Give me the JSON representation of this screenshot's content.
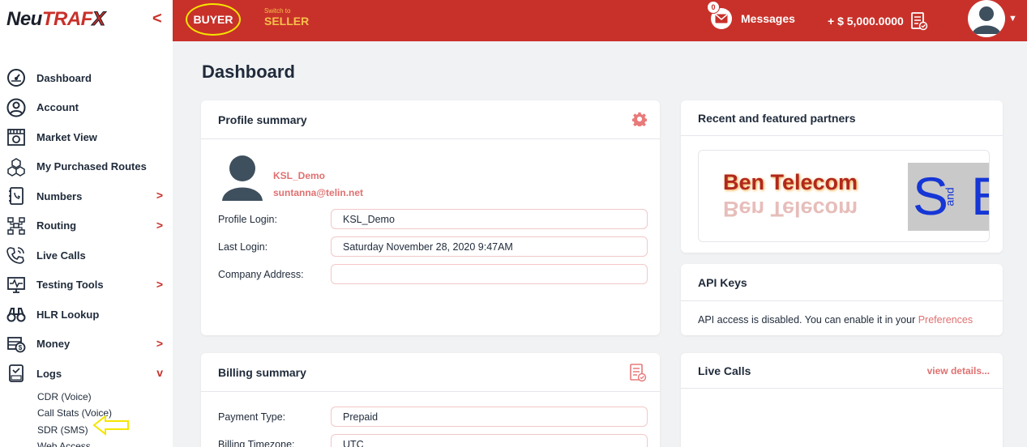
{
  "brand": {
    "neu": "Neu",
    "traf": "TRAF",
    "x": "X"
  },
  "sidebar": {
    "collapse_label": "<",
    "items": [
      {
        "label": "Dashboard",
        "icon": "speedometer-icon",
        "arrow": ""
      },
      {
        "label": "Account",
        "icon": "user-circle-icon",
        "arrow": ""
      },
      {
        "label": "Market View",
        "icon": "market-icon",
        "arrow": ""
      },
      {
        "label": "My Purchased Routes",
        "icon": "cubes-icon",
        "arrow": ""
      },
      {
        "label": "Numbers",
        "icon": "phone-book-icon",
        "arrow": ">"
      },
      {
        "label": "Routing",
        "icon": "network-icon",
        "arrow": ">"
      },
      {
        "label": "Live Calls",
        "icon": "phone-call-icon",
        "arrow": ""
      },
      {
        "label": "Testing Tools",
        "icon": "monitor-test-icon",
        "arrow": ">"
      },
      {
        "label": "HLR Lookup",
        "icon": "binoculars-icon",
        "arrow": ""
      },
      {
        "label": "Money",
        "icon": "money-icon",
        "arrow": ">"
      },
      {
        "label": "Logs",
        "icon": "log-file-icon",
        "arrow": "v"
      }
    ],
    "logs_sub": [
      "CDR (Voice)",
      "Call Stats (Voice)",
      "SDR (SMS)",
      "Web Access"
    ]
  },
  "topbar": {
    "buyer": "BUYER",
    "switch_small": "Switch to",
    "switch_big": "SELLER",
    "messages_label": "Messages",
    "messages_count": "0",
    "balance": "+ $ 5,000.0000",
    "accent": "#c8312a",
    "highlight": "#f5e600"
  },
  "main": {
    "title": "Dashboard",
    "profile": {
      "title": "Profile summary",
      "username": "KSL_Demo",
      "email": "suntanna@telin.net",
      "fields": [
        {
          "label": "Profile Login:",
          "value": "KSL_Demo"
        },
        {
          "label": "Last Login:",
          "value": "Saturday November 28, 2020 9:47AM"
        },
        {
          "label": "Company Address:",
          "value": ""
        }
      ]
    },
    "partners": {
      "title": "Recent and featured partners",
      "ben": "Ben Telecom",
      "sb_s": "S",
      "sb_and": "and",
      "sb_b": "B"
    },
    "api": {
      "title": "API Keys",
      "text": "API access is disabled. You can enable it in your",
      "link": "Preferences"
    },
    "billing": {
      "title": "Billing summary",
      "fields": [
        {
          "label": "Payment Type:",
          "value": "Prepaid"
        },
        {
          "label": "Billing Timezone:",
          "value": "UTC"
        }
      ]
    },
    "live_calls": {
      "title": "Live Calls",
      "link": "view details..."
    }
  }
}
